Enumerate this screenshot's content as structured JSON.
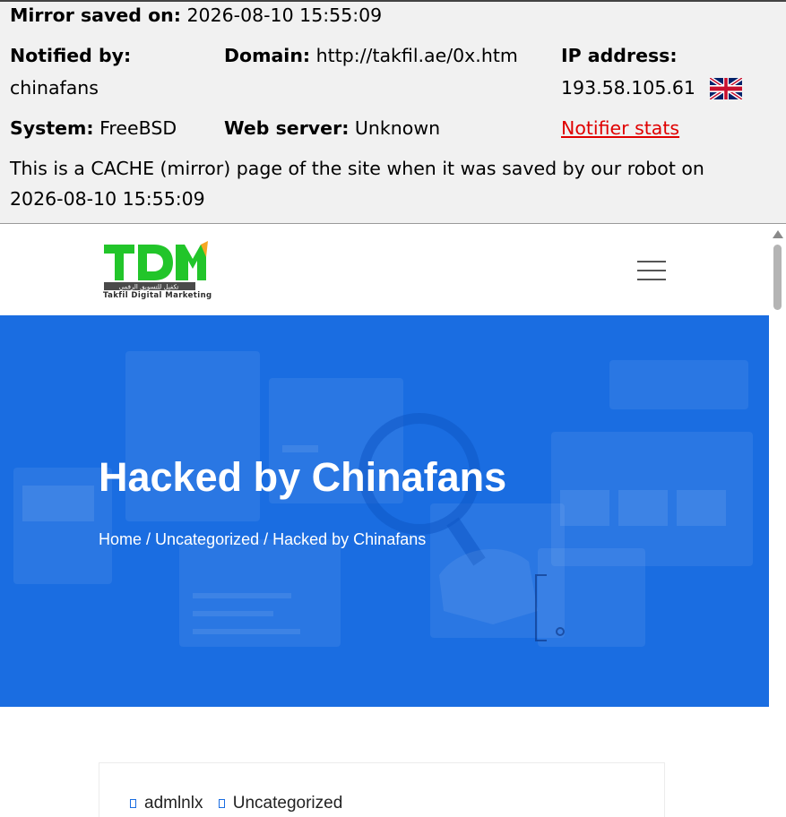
{
  "mirror": {
    "saved_label": "Mirror saved on:",
    "saved_value": "2026-08-10 15:55:09",
    "notified_label": "Notified by:",
    "notified_value": "chinafans",
    "domain_label": "Domain:",
    "domain_value": "http://takfil.ae/0x.htm",
    "ip_label": "IP address:",
    "ip_value": "193.58.105.61",
    "flag_icon": "uk-flag-icon",
    "system_label": "System:",
    "system_value": "FreeBSD",
    "webserver_label": "Web server:",
    "webserver_value": "Unknown",
    "notifier_stats": "Notifier stats",
    "cache_notice_line1": "This is a CACHE (mirror) page of the site when it was saved by our robot on",
    "cache_notice_line2": "2026-08-10 15:55:09"
  },
  "site": {
    "logo_text": "TDM",
    "logo_arabic": "تكفيل للتسويق الرقمي",
    "logo_subtitle": "Takfil Digital Marketing",
    "menu_icon": "hamburger-menu-icon",
    "hero_title": "Hacked by Chinafans",
    "breadcrumb": {
      "home": "Home",
      "sep1": " / ",
      "category": "Uncategorized",
      "sep2": " / ",
      "current": "Hacked by Chinafans"
    },
    "post_meta": {
      "author": "admlnlx",
      "category": "Uncategorized"
    }
  },
  "colors": {
    "hero_blue": "#1a6de1",
    "logo_green": "#22c52a",
    "link_red": "#e00000",
    "header_bg": "#f1f1f1"
  }
}
